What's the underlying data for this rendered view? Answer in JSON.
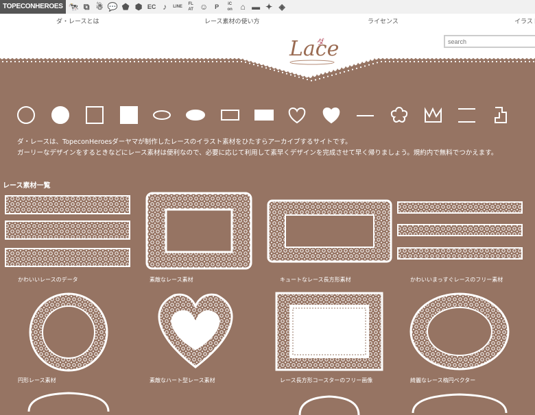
{
  "topbar": {
    "brand": "TOPECONHEROES",
    "icons": [
      {
        "name": "cow-icon"
      },
      {
        "name": "copy-icon"
      },
      {
        "name": "person-icon"
      },
      {
        "name": "speech-bubble-icon"
      },
      {
        "name": "tag-icon"
      },
      {
        "name": "pentagon-icon"
      },
      {
        "name": "ec-icon",
        "text": "EC"
      },
      {
        "name": "music-note-icon"
      },
      {
        "name": "line-icon",
        "text": "LINE"
      },
      {
        "name": "flat-icon",
        "text": "FL\nAT"
      },
      {
        "name": "smiley-icon"
      },
      {
        "name": "p-icon",
        "text": "P"
      },
      {
        "name": "icon-text-icon",
        "text": "iC\non"
      },
      {
        "name": "house-icon"
      },
      {
        "name": "car-icon"
      },
      {
        "name": "sparkle-person-icon"
      },
      {
        "name": "gift-icon"
      }
    ]
  },
  "nav": {
    "items": [
      "ダ・レースとは",
      "レース素材の使い方",
      "ライセンス",
      "イラスト"
    ]
  },
  "search": {
    "placeholder": "search"
  },
  "logo": {
    "text": "Lace",
    "accent": "ダ"
  },
  "shapes": [
    "circle",
    "filled-circle",
    "square",
    "filled-square",
    "ellipse",
    "filled-ellipse",
    "rectangle",
    "filled-rectangle",
    "heart",
    "filled-heart",
    "line",
    "flower",
    "crown",
    "double-line",
    "stairs"
  ],
  "intro": {
    "line1": "ダ・レースは、TopeconHeroesダーヤマが制作したレースのイラスト素材をひたすらアーカイブするサイトです。",
    "line2": "ガーリーなデザインをするときなどにレース素材は便利なので、必要に応じて利用して素早くデザインを完成させて早く帰りましょう。規約内で無料でつかえます。"
  },
  "section": {
    "title": "レース素材一覧"
  },
  "items": [
    {
      "caption": "かわいいレースのデータ",
      "kind": "strips"
    },
    {
      "caption": "素敵なレース素材",
      "kind": "frame-square"
    },
    {
      "caption": "キュートなレース長方形素材",
      "kind": "frame-rect"
    },
    {
      "caption": "かわいいまっすぐレースのフリー素材",
      "kind": "strips-thin"
    },
    {
      "caption": "円形レース素材",
      "kind": "circle"
    },
    {
      "caption": "素敵なハート型レース素材",
      "kind": "heart"
    },
    {
      "caption": "レース長方形コースターのフリー画像",
      "kind": "coaster"
    },
    {
      "caption": "綺麗なレース楕円ベクター",
      "kind": "oval"
    }
  ],
  "colors": {
    "background": "#967463",
    "header": "#ffffff",
    "lace": "#ffffff",
    "logo": "#9a6b52"
  }
}
